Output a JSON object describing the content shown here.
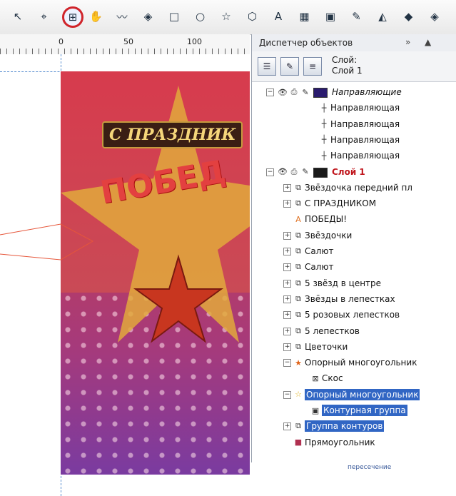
{
  "toolbar": {
    "tools": [
      {
        "icon": "pick-tool-icon",
        "glyph": "↖"
      },
      {
        "icon": "shape-tool-icon",
        "glyph": "⌖"
      },
      {
        "icon": "crop-tool-icon",
        "glyph": "⊞",
        "active": true
      },
      {
        "icon": "pan-tool-icon",
        "glyph": "✋"
      },
      {
        "icon": "freehand-tool-icon",
        "glyph": "〰"
      },
      {
        "icon": "smart-fill-tool-icon",
        "glyph": "◈"
      },
      {
        "icon": "rectangle-tool-icon",
        "glyph": "□"
      },
      {
        "icon": "ellipse-tool-icon",
        "glyph": "○"
      },
      {
        "icon": "polygon-tool-icon",
        "glyph": "☆"
      },
      {
        "icon": "basic-shapes-tool-icon",
        "glyph": "⬡"
      },
      {
        "icon": "text-tool-icon",
        "glyph": "A"
      },
      {
        "icon": "table-tool-icon",
        "glyph": "▦"
      },
      {
        "icon": "contour-tool-icon",
        "glyph": "▣"
      },
      {
        "icon": "eyedropper-tool-icon",
        "glyph": "✎"
      },
      {
        "icon": "outline-tool-icon",
        "glyph": "◭"
      },
      {
        "icon": "fill-tool-icon",
        "glyph": "◆"
      },
      {
        "icon": "interactive-fill-tool-icon",
        "glyph": "◈"
      }
    ]
  },
  "ruler": {
    "labels": [
      "0",
      "50",
      "100"
    ]
  },
  "canvas": {
    "poster_title": "С ПРАЗДНИК",
    "poster_victory": "ПОБЕД",
    "intersect_label": "пересечение"
  },
  "docker": {
    "title": "Диспетчер объектов",
    "chevron": "»",
    "arrow": "▲",
    "layer_label": "Слой:",
    "layer_name": "Слой 1",
    "tree": [
      {
        "level": 0,
        "expander": "⊟",
        "type": "layer",
        "label": "Направляющие",
        "style": "italic",
        "swatch": "#2a1b6e"
      },
      {
        "level": 2,
        "type": "guide",
        "label": "Направляющая"
      },
      {
        "level": 2,
        "type": "guide",
        "label": "Направляющая"
      },
      {
        "level": 2,
        "type": "guide",
        "label": "Направляющая"
      },
      {
        "level": 2,
        "type": "guide",
        "label": "Направляющая"
      },
      {
        "level": 0,
        "expander": "⊟",
        "type": "layer",
        "label": "Слой 1",
        "style": "red",
        "swatch": "#1a1a1a"
      },
      {
        "level": 1,
        "expander": "⊞",
        "type": "group",
        "label": "Звёздочка передний пл"
      },
      {
        "level": 1,
        "expander": "⊞",
        "type": "group",
        "label": "С ПРАЗДНИКОМ"
      },
      {
        "level": 1,
        "type": "text",
        "label": "ПОБЕДЫ!"
      },
      {
        "level": 1,
        "expander": "⊞",
        "type": "group",
        "label": "Звёздочки"
      },
      {
        "level": 1,
        "expander": "⊞",
        "type": "group",
        "label": "Салют"
      },
      {
        "level": 1,
        "expander": "⊞",
        "type": "group",
        "label": "Салют"
      },
      {
        "level": 1,
        "expander": "⊞",
        "type": "group",
        "label": "5 звёзд в центре"
      },
      {
        "level": 1,
        "expander": "⊞",
        "type": "group",
        "label": "Звёзды в лепестках"
      },
      {
        "level": 1,
        "expander": "⊞",
        "type": "group",
        "label": "5 розовых лепестков"
      },
      {
        "level": 1,
        "expander": "⊞",
        "type": "group",
        "label": "5 лепестков"
      },
      {
        "level": 1,
        "expander": "⊞",
        "type": "group",
        "label": "Цветочки"
      },
      {
        "level": 1,
        "expander": "⊟",
        "type": "star",
        "label": "Опорный многоугольник"
      },
      {
        "level": 2,
        "type": "bevel",
        "label": "Скос"
      },
      {
        "level": 1,
        "expander": "⊟",
        "type": "star-outline",
        "label": "Опорный многоугольник",
        "selected": true
      },
      {
        "level": 2,
        "type": "contour",
        "label": "Контурная группа",
        "selected": true
      },
      {
        "level": 1,
        "expander": "⊞",
        "type": "group",
        "label": "Группа контуров",
        "selected": true
      },
      {
        "level": 1,
        "type": "rect",
        "label": "Прямоугольник"
      }
    ]
  }
}
